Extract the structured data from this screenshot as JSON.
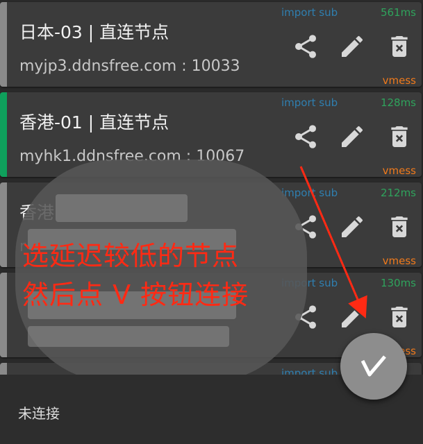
{
  "servers": [
    {
      "name": "日本-03 | 直连节点",
      "address": "myjp3.ddnsfree.com : 10033",
      "sub": "import sub",
      "delay": "561ms",
      "protocol": "vmess"
    },
    {
      "name": "香港-01 | 直连节点",
      "address": "myhk1.ddnsfree.com : 10067",
      "sub": "import sub",
      "delay": "128ms",
      "protocol": "vmess"
    },
    {
      "name": "香港",
      "address": "r",
      "sub": "import sub",
      "delay": "212ms",
      "protocol": "vmess"
    },
    {
      "name": "",
      "address": "",
      "sub": "import sub",
      "delay": "130ms",
      "protocol": "vmess"
    },
    {
      "name": "",
      "address": "",
      "sub": "import sub",
      "delay": "",
      "protocol": ""
    }
  ],
  "annotation": {
    "line1": "选延迟较低的节点",
    "line2": "然后点 V 按钮连接"
  },
  "status": {
    "text": "未连接"
  },
  "colors": {
    "card_bg": "#3b3b3b",
    "active_stripe": "#0fa05c",
    "delay": "#2fa35c",
    "protocol": "#f07a1c",
    "sub": "#2f7fb0",
    "annotation": "#ff2a14"
  },
  "icons": [
    "share-icon",
    "edit-icon",
    "delete-icon",
    "v2ray-connect-icon"
  ]
}
